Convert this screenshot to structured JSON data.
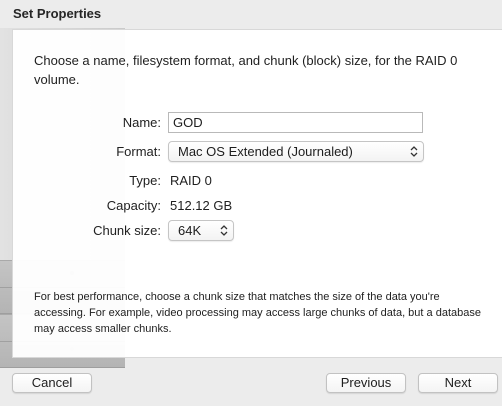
{
  "window": {
    "title": "Set Properties"
  },
  "intro_text": "Choose a name, filesystem format, and chunk (block) size, for the RAID 0 volume.",
  "form": {
    "name": {
      "label": "Name:",
      "value": "GOD"
    },
    "format": {
      "label": "Format:",
      "selected": "Mac OS Extended (Journaled)"
    },
    "type": {
      "label": "Type:",
      "value": "RAID 0"
    },
    "capacity": {
      "label": "Capacity:",
      "value": "512.12 GB"
    },
    "chunk_size": {
      "label": "Chunk size:",
      "selected": "64K"
    }
  },
  "footnote": "For best performance, choose a chunk size that matches the size of the data you're accessing. For example, video processing may access large chunks of data, but a database may access smaller chunks.",
  "buttons": {
    "cancel": "Cancel",
    "previous": "Previous",
    "next": "Next"
  },
  "icons": {
    "popup_stepper": "up-down-chevron-icon",
    "drive_art": "hard-drive-illustration"
  }
}
